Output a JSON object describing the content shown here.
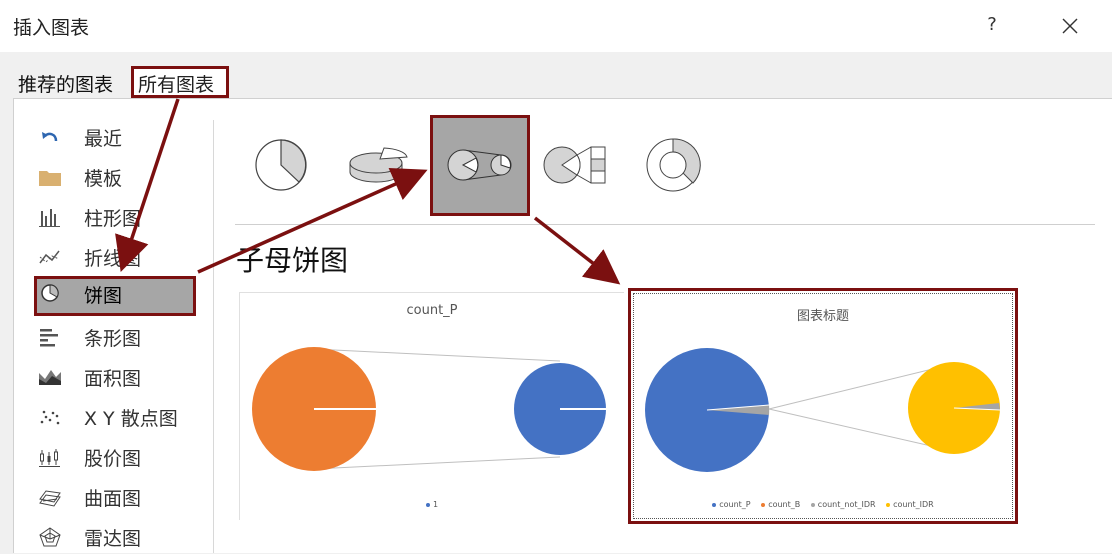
{
  "window": {
    "title": "插入图表",
    "help": "?"
  },
  "tabs": {
    "recommended": "推荐的图表",
    "all": "所有图表"
  },
  "sidebar": {
    "items": [
      {
        "label": "最近",
        "icon": "recent-arrow-icon"
      },
      {
        "label": "模板",
        "icon": "folder-icon"
      },
      {
        "label": "柱形图",
        "icon": "column-chart-icon"
      },
      {
        "label": "折线图",
        "icon": "line-chart-icon"
      },
      {
        "label": "饼图",
        "icon": "pie-chart-icon",
        "selected": true
      },
      {
        "label": "条形图",
        "icon": "bar-chart-icon"
      },
      {
        "label": "面积图",
        "icon": "area-chart-icon"
      },
      {
        "label": "X Y 散点图",
        "icon": "scatter-chart-icon"
      },
      {
        "label": "股价图",
        "icon": "stock-chart-icon"
      },
      {
        "label": "曲面图",
        "icon": "surface-chart-icon"
      },
      {
        "label": "雷达图",
        "icon": "radar-chart-icon"
      }
    ]
  },
  "subtypes": [
    {
      "name": "pie",
      "icon": "pie-icon"
    },
    {
      "name": "3d-pie",
      "icon": "3d-pie-icon"
    },
    {
      "name": "pie-of-pie",
      "icon": "pie-of-pie-icon",
      "selected": true
    },
    {
      "name": "bar-of-pie",
      "icon": "bar-of-pie-icon"
    },
    {
      "name": "doughnut",
      "icon": "doughnut-icon"
    }
  ],
  "selected_heading": "子母饼图",
  "preview1": {
    "title": "count_P",
    "legend": [
      "1"
    ]
  },
  "preview2": {
    "title": "图表标题",
    "legend": [
      "count_P",
      "count_B",
      "count_not_IDR",
      "count_IDR"
    ]
  },
  "colors": {
    "highlight": "#7b1010",
    "orange": "#ED7D31",
    "blue": "#4472C4",
    "gray": "#A5A5A5",
    "yellow": "#FFC000"
  }
}
